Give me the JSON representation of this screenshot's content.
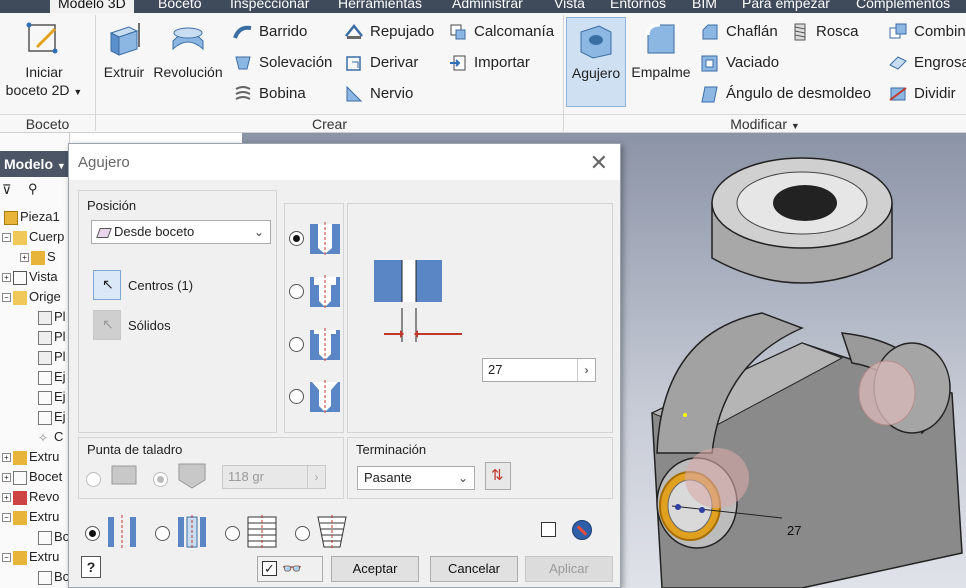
{
  "menu_tabs": [
    "Modelo 3D",
    "Boceto",
    "Inspeccionar",
    "Herramientas",
    "Administrar",
    "Vista",
    "Entornos",
    "BIM",
    "Para empezar",
    "Complementos"
  ],
  "ribbon": {
    "boceto": {
      "btn_line1": "Iniciar",
      "btn_line2": "boceto 2D",
      "footer": "Boceto"
    },
    "crear": {
      "extruir": "Extruir",
      "revolucion": "Revolución",
      "barrido": "Barrido",
      "solevacion": "Solevación",
      "bobina": "Bobina",
      "repujado": "Repujado",
      "derivar": "Derivar",
      "nervio": "Nervio",
      "calcomania": "Calcomanía",
      "importar": "Importar",
      "footer": "Crear"
    },
    "modificar": {
      "agujero": "Agujero",
      "empalme": "Empalme",
      "chaflan": "Chaflán",
      "vaciado": "Vaciado",
      "angulo": "Ángulo de desmoldeo",
      "rosca": "Rosca",
      "combinar": "Combin",
      "engrosar": "Engrosa",
      "dividir": "Dividir",
      "footer": "Modificar"
    }
  },
  "browser": {
    "header": "Modelo",
    "items": [
      "Pieza1",
      "Cuerp",
      "S",
      "Vista",
      "Orige",
      "Pl",
      "Pl",
      "Pl",
      "Ej",
      "Ej",
      "Ej",
      "C",
      "Extru",
      "Bocet",
      "Revo",
      "Extru",
      "Bo",
      "Extru",
      "Bo"
    ]
  },
  "dialog": {
    "title": "Agujero",
    "posicion": {
      "label": "Posición",
      "combo_value": "Desde boceto",
      "centros": "Centros (1)",
      "solidos": "Sólidos"
    },
    "diameter_value": "27",
    "punta": {
      "label": "Punta de taladro",
      "angle_value": "118 gr"
    },
    "terminacion": {
      "label": "Terminación",
      "value": "Pasante"
    },
    "buttons": {
      "aceptar": "Aceptar",
      "cancelar": "Cancelar",
      "aplicar": "Aplicar"
    }
  },
  "viewport": {
    "dimension_label": "27"
  }
}
